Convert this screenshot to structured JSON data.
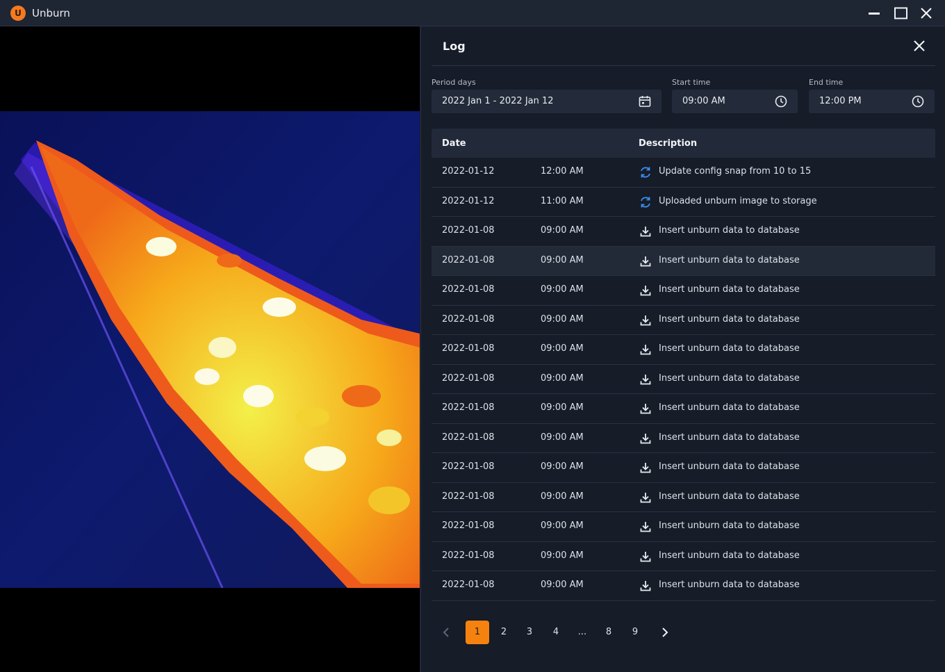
{
  "window": {
    "logo_letter": "U",
    "title": "Unburn",
    "controls": [
      "minimize-icon",
      "maximize-icon",
      "close-icon"
    ]
  },
  "colors": {
    "accent": "#f5820f",
    "panel_bg": "#161c28",
    "field_bg": "#232b3a",
    "refresh_icon": "#3b8ff0"
  },
  "log": {
    "title": "Log",
    "filters": {
      "period_label": "Period days",
      "period_value": "2022 Jan 1 - 2022 Jan 12",
      "start_label": "Start time",
      "start_value": "09:00 AM",
      "end_label": "End time",
      "end_value": "12:00 PM"
    },
    "table": {
      "headers": {
        "date": "Date",
        "description": "Description"
      },
      "rows": [
        {
          "date": "2022-01-12",
          "time": "12:00 AM",
          "icon": "refresh-icon",
          "description": "Update config snap from 10 to 15"
        },
        {
          "date": "2022-01-12",
          "time": "11:00 AM",
          "icon": "refresh-icon",
          "description": "Uploaded unburn image to storage"
        },
        {
          "date": "2022-01-08",
          "time": "09:00 AM",
          "icon": "download-icon",
          "description": "Insert unburn data to database"
        },
        {
          "date": "2022-01-08",
          "time": "09:00 AM",
          "icon": "download-icon",
          "description": "Insert unburn data to database",
          "highlighted": true
        },
        {
          "date": "2022-01-08",
          "time": "09:00 AM",
          "icon": "download-icon",
          "description": "Insert unburn data to database"
        },
        {
          "date": "2022-01-08",
          "time": "09:00 AM",
          "icon": "download-icon",
          "description": "Insert unburn data to database"
        },
        {
          "date": "2022-01-08",
          "time": "09:00 AM",
          "icon": "download-icon",
          "description": "Insert unburn data to database"
        },
        {
          "date": "2022-01-08",
          "time": "09:00 AM",
          "icon": "download-icon",
          "description": "Insert unburn data to database"
        },
        {
          "date": "2022-01-08",
          "time": "09:00 AM",
          "icon": "download-icon",
          "description": "Insert unburn data to database"
        },
        {
          "date": "2022-01-08",
          "time": "09:00 AM",
          "icon": "download-icon",
          "description": "Insert unburn data to database"
        },
        {
          "date": "2022-01-08",
          "time": "09:00 AM",
          "icon": "download-icon",
          "description": "Insert unburn data to database"
        },
        {
          "date": "2022-01-08",
          "time": "09:00 AM",
          "icon": "download-icon",
          "description": "Insert unburn data to database"
        },
        {
          "date": "2022-01-08",
          "time": "09:00 AM",
          "icon": "download-icon",
          "description": "Insert unburn data to database"
        },
        {
          "date": "2022-01-08",
          "time": "09:00 AM",
          "icon": "download-icon",
          "description": "Insert unburn data to database"
        },
        {
          "date": "2022-01-08",
          "time": "09:00 AM",
          "icon": "download-icon",
          "description": "Insert unburn data to database"
        }
      ]
    },
    "pagination": {
      "pages": [
        "1",
        "2",
        "3",
        "4",
        "...",
        "8",
        "9"
      ],
      "current": "1"
    }
  }
}
